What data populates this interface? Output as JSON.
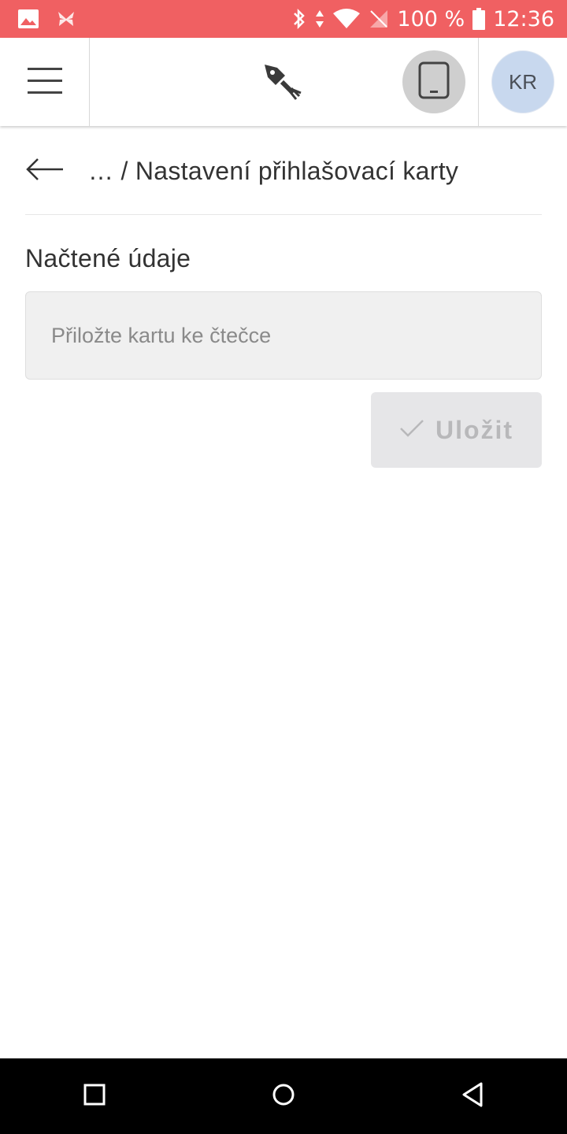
{
  "status_bar": {
    "battery_percent": "100 %",
    "time": "12:36",
    "icons": [
      "image-icon",
      "app-notification-icon",
      "bluetooth-icon",
      "data-arrows-icon",
      "wifi-icon",
      "no-sim-icon",
      "battery-icon"
    ]
  },
  "app_bar": {
    "menu_icon": "hamburger-menu-icon",
    "logo_icon": "rocket-fork-logo-icon",
    "device_icon": "tablet-icon",
    "avatar_initials": "KR"
  },
  "breadcrumb": {
    "text": "… / Nastavení přihlašovací karty"
  },
  "section": {
    "title": "Načtené údaje",
    "card_input_placeholder": "Přiložte kartu ke čtečce"
  },
  "actions": {
    "save_label": "Uložit"
  },
  "colors": {
    "status_bar": "#f06062",
    "avatar_bg": "#c8d8ee",
    "device_button_bg": "#cfcfcf",
    "disabled_button_bg": "#e6e6e8",
    "disabled_text": "#b8b8ba"
  }
}
